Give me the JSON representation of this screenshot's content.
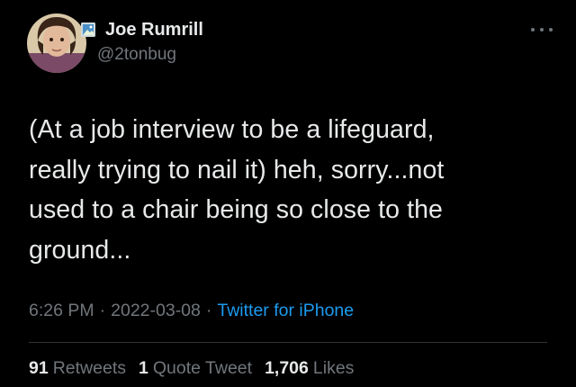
{
  "author": {
    "name": "Joe Rumrill",
    "handle": "@2tonbug",
    "badge_icon": "picture-frame-icon"
  },
  "more_icon": "more-options-icon",
  "tweet": {
    "text": "(At a job interview to be a lifeguard,\nreally trying to nail it) heh, sorry...not\nused to a chair being so close to the\nground..."
  },
  "meta": {
    "time": "6:26 PM",
    "separator": "·",
    "date": "2022-03-08",
    "source": "Twitter for iPhone"
  },
  "stats": {
    "retweets": {
      "count": "91",
      "label": "Retweets"
    },
    "quotes": {
      "count": "1",
      "label": "Quote Tweet"
    },
    "likes": {
      "count": "1,706",
      "label": "Likes"
    }
  },
  "colors": {
    "background": "#000000",
    "primary_text": "#e7e9ea",
    "secondary_text": "#71767b",
    "link": "#1d9bf0",
    "divider": "#2f3336"
  }
}
